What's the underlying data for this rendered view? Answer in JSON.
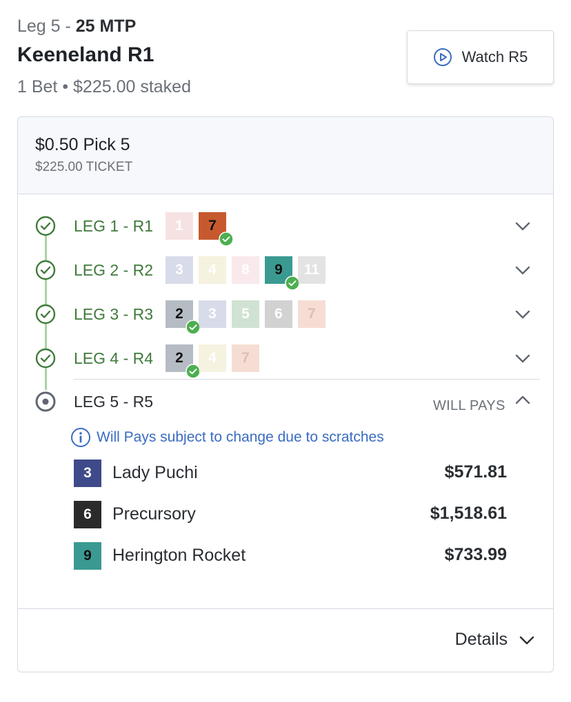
{
  "header": {
    "leg_prefix": "Leg 5 - ",
    "mtp": "25 MTP",
    "title": "Keeneland R1",
    "subtitle": "1 Bet • $225.00 staked",
    "watch_label": "Watch R5"
  },
  "bet": {
    "type": "$0.50 Pick 5",
    "ticket": "$225.00 TICKET"
  },
  "legs": [
    {
      "label": "LEG 1 - R1",
      "status": "won",
      "chips": [
        {
          "n": "1",
          "bg": "#e8b4b4",
          "fg": "#ffffff",
          "faded": true
        },
        {
          "n": "7",
          "bg": "#c65a2e",
          "fg": "#111111",
          "faded": false,
          "winner": true
        }
      ]
    },
    {
      "label": "LEG 2 - R2",
      "status": "won",
      "chips": [
        {
          "n": "3",
          "bg": "#9aa2c8",
          "fg": "#ffffff",
          "faded": true
        },
        {
          "n": "4",
          "bg": "#e8dfb0",
          "fg": "#ffffff",
          "faded": true
        },
        {
          "n": "8",
          "bg": "#f0c8cf",
          "fg": "#ffffff",
          "faded": true
        },
        {
          "n": "9",
          "bg": "#3a9a92",
          "fg": "#111111",
          "faded": false,
          "winner": true
        },
        {
          "n": "11",
          "bg": "#b8b8b8",
          "fg": "#ffffff",
          "faded": true
        }
      ]
    },
    {
      "label": "LEG 3 - R3",
      "status": "won",
      "chips": [
        {
          "n": "2",
          "bg": "#b5bcc4",
          "fg": "#111111",
          "faded": false,
          "winner": true
        },
        {
          "n": "3",
          "bg": "#9aa2c8",
          "fg": "#ffffff",
          "faded": true
        },
        {
          "n": "5",
          "bg": "#86b487",
          "fg": "#ffffff",
          "faded": true
        },
        {
          "n": "6",
          "bg": "#8a8a8a",
          "fg": "#ffffff",
          "faded": true
        },
        {
          "n": "7",
          "bg": "#eaa78f",
          "fg": "#9a5a4a",
          "faded": true
        }
      ]
    },
    {
      "label": "LEG 4 - R4",
      "status": "won",
      "chips": [
        {
          "n": "2",
          "bg": "#b5bcc4",
          "fg": "#111111",
          "faded": false,
          "winner": true
        },
        {
          "n": "4",
          "bg": "#e8dfb0",
          "fg": "#ffffff",
          "faded": true
        },
        {
          "n": "7",
          "bg": "#eaa78f",
          "fg": "#9a5a4a",
          "faded": true
        }
      ]
    }
  ],
  "current_leg": {
    "label": "LEG 5 - R5",
    "will_pays_label": "WILL PAYS",
    "info": "Will Pays subject to change due to scratches",
    "runners": [
      {
        "num": "3",
        "name": "Lady Puchi",
        "pay": "$571.81",
        "bg": "#3e4a8a",
        "fg": "#ffffff"
      },
      {
        "num": "6",
        "name": "Precursory",
        "pay": "$1,518.61",
        "bg": "#2b2b2b",
        "fg": "#ffffff"
      },
      {
        "num": "9",
        "name": "Herington Rocket",
        "pay": "$733.99",
        "bg": "#3a9a92",
        "fg": "#111111"
      }
    ]
  },
  "footer": {
    "details_label": "Details"
  },
  "colors": {
    "won_green": "#3f7a3b",
    "check_green": "#4caf50",
    "info_blue": "#3a6cc2",
    "timeline": "#a9d3a3"
  },
  "icons": {
    "watch": "play-circle-icon",
    "won": "check-circle-icon",
    "current": "radio-dot-icon",
    "expand": "chevron-down-icon",
    "collapse": "chevron-up-icon",
    "info": "info-icon"
  }
}
